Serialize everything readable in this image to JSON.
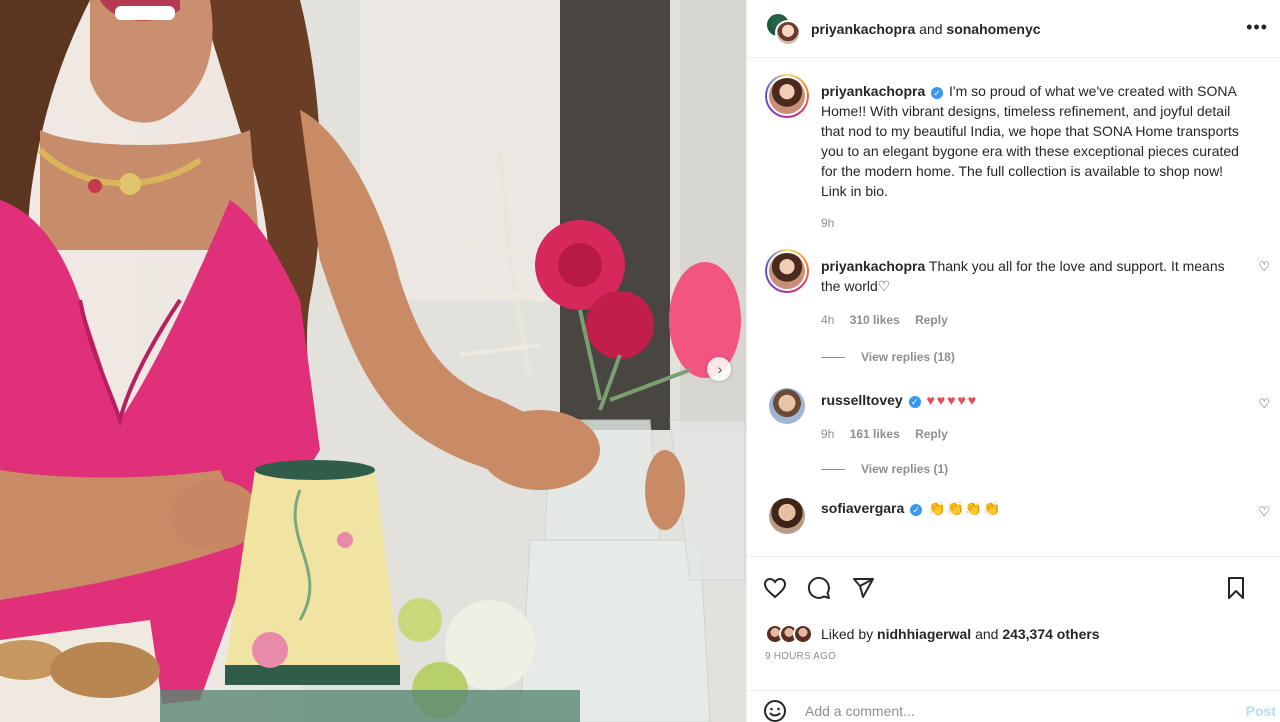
{
  "header": {
    "user1": "priyankachopra",
    "and_text": "and",
    "user2": "sonahomenyc",
    "more_icon": "more-horizontal-icon"
  },
  "caption": {
    "username": "priyankachopra",
    "text": "I'm so proud of what we've created with SONA Home!! With vibrant designs, timeless refinement, and joyful detail that nod to my beautiful India, we hope that SONA Home transports you to an elegant bygone era with these exceptional pieces curated for the modern home. The full collection is available to shop now! Link in bio.",
    "time": "9h"
  },
  "comments": [
    {
      "username": "priyankachopra",
      "text": "Thank you all for the love and support. It means the world♡",
      "time": "4h",
      "likes": "310 likes",
      "reply": "Reply",
      "view_replies": "View replies (18)"
    },
    {
      "username": "russelltovey",
      "text": "♥♥♥♥♥",
      "time": "9h",
      "likes": "161 likes",
      "reply": "Reply",
      "view_replies": "View replies (1)"
    },
    {
      "username": "sofiavergara",
      "text": "👏👏👏👏"
    }
  ],
  "actions": {
    "icons": [
      "heart-icon",
      "comment-icon",
      "share-icon",
      "bookmark-icon"
    ],
    "liked_by_prefix": "Liked by",
    "liked_by_user": "nidhhiagerwal",
    "liked_by_and": "and",
    "liked_by_others": "243,374 others",
    "time_ago": "9 HOURS AGO"
  },
  "comment_box": {
    "placeholder": "Add a comment...",
    "post_label": "Post"
  },
  "colors": {
    "verified": "#3897f0",
    "post_button_disabled": "#b2dffc",
    "hearts": "#ed4956",
    "dress": "#e0307a"
  }
}
